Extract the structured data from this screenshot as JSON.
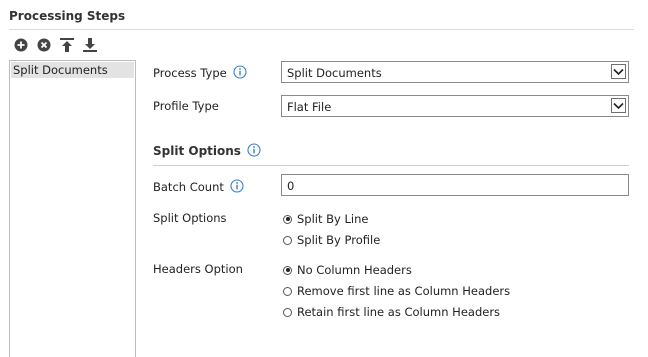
{
  "panel": {
    "title": "Processing Steps"
  },
  "toolbar": {
    "icons": [
      "add-icon",
      "remove-icon",
      "move-to-top-icon",
      "move-to-bottom-icon"
    ]
  },
  "steps": {
    "items": [
      "Split Documents"
    ]
  },
  "form": {
    "process_type": {
      "label": "Process Type",
      "value": "Split Documents"
    },
    "profile_type": {
      "label": "Profile Type",
      "value": "Flat File"
    },
    "section_title": "Split Options",
    "batch_count": {
      "label": "Batch Count",
      "value": "0"
    },
    "split_options": {
      "label": "Split Options",
      "options": [
        "Split By Line",
        "Split By Profile"
      ],
      "selected": "Split By Line"
    },
    "headers_option": {
      "label": "Headers Option",
      "options": [
        "No Column Headers",
        "Remove first line as Column Headers",
        "Retain first line as Column Headers"
      ],
      "selected": "No Column Headers"
    }
  },
  "colors": {
    "info_icon": "#3b7fc4",
    "toolbar_icon": "#444444",
    "selected_item_bg": "#e3e3e3"
  }
}
